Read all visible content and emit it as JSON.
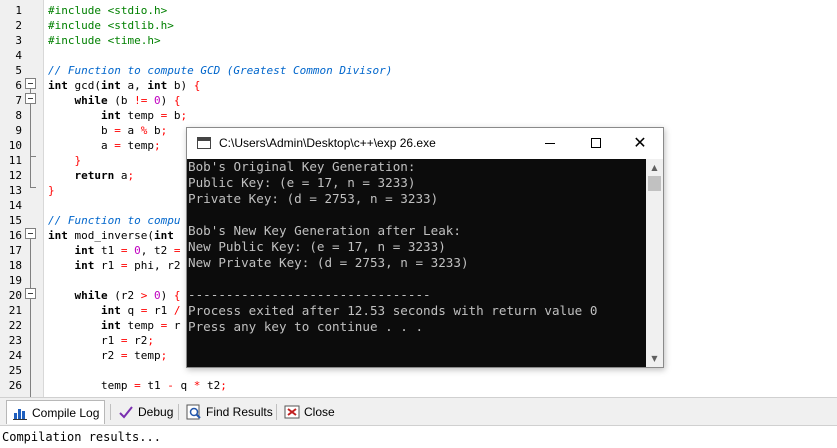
{
  "editor": {
    "lines": [
      {
        "n": "1",
        "tokens": [
          {
            "t": "#include <stdio.h>",
            "c": "tok-pre"
          }
        ]
      },
      {
        "n": "2",
        "tokens": [
          {
            "t": "#include <stdlib.h>",
            "c": "tok-pre"
          }
        ]
      },
      {
        "n": "3",
        "tokens": [
          {
            "t": "#include <time.h>",
            "c": "tok-pre"
          }
        ]
      },
      {
        "n": "4",
        "tokens": []
      },
      {
        "n": "5",
        "tokens": [
          {
            "t": "// Function to compute GCD (Greatest Common Divisor)",
            "c": "tok-cm"
          }
        ]
      },
      {
        "n": "6",
        "tokens": [
          {
            "t": "int",
            "c": "tok-kw"
          },
          {
            "t": " gcd(",
            "c": ""
          },
          {
            "t": "int",
            "c": "tok-kw"
          },
          {
            "t": " a, ",
            "c": ""
          },
          {
            "t": "int",
            "c": "tok-kw"
          },
          {
            "t": " b) ",
            "c": ""
          },
          {
            "t": "{",
            "c": "tok-op"
          }
        ]
      },
      {
        "n": "7",
        "tokens": [
          {
            "t": "    ",
            "c": ""
          },
          {
            "t": "while",
            "c": "tok-kw"
          },
          {
            "t": " (b ",
            "c": ""
          },
          {
            "t": "!=",
            "c": "tok-op"
          },
          {
            "t": " ",
            "c": ""
          },
          {
            "t": "0",
            "c": "tok-num"
          },
          {
            "t": ") ",
            "c": ""
          },
          {
            "t": "{",
            "c": "tok-op"
          }
        ]
      },
      {
        "n": "8",
        "tokens": [
          {
            "t": "        ",
            "c": ""
          },
          {
            "t": "int",
            "c": "tok-kw"
          },
          {
            "t": " temp ",
            "c": ""
          },
          {
            "t": "=",
            "c": "tok-op"
          },
          {
            "t": " b",
            "c": ""
          },
          {
            "t": ";",
            "c": "tok-op"
          }
        ]
      },
      {
        "n": "9",
        "tokens": [
          {
            "t": "        b ",
            "c": ""
          },
          {
            "t": "=",
            "c": "tok-op"
          },
          {
            "t": " a ",
            "c": ""
          },
          {
            "t": "%",
            "c": "tok-op"
          },
          {
            "t": " b",
            "c": ""
          },
          {
            "t": ";",
            "c": "tok-op"
          }
        ]
      },
      {
        "n": "10",
        "tokens": [
          {
            "t": "        a ",
            "c": ""
          },
          {
            "t": "=",
            "c": "tok-op"
          },
          {
            "t": " temp",
            "c": ""
          },
          {
            "t": ";",
            "c": "tok-op"
          }
        ]
      },
      {
        "n": "11",
        "tokens": [
          {
            "t": "    ",
            "c": ""
          },
          {
            "t": "}",
            "c": "tok-op"
          }
        ]
      },
      {
        "n": "12",
        "tokens": [
          {
            "t": "    ",
            "c": ""
          },
          {
            "t": "return",
            "c": "tok-kw"
          },
          {
            "t": " a",
            "c": ""
          },
          {
            "t": ";",
            "c": "tok-op"
          }
        ]
      },
      {
        "n": "13",
        "tokens": [
          {
            "t": "}",
            "c": "tok-op"
          }
        ]
      },
      {
        "n": "14",
        "tokens": []
      },
      {
        "n": "15",
        "tokens": [
          {
            "t": "// Function to compu",
            "c": "tok-cm"
          }
        ]
      },
      {
        "n": "16",
        "tokens": [
          {
            "t": "int",
            "c": "tok-kw"
          },
          {
            "t": " mod_inverse(",
            "c": ""
          },
          {
            "t": "int",
            "c": "tok-kw"
          }
        ]
      },
      {
        "n": "17",
        "tokens": [
          {
            "t": "    ",
            "c": ""
          },
          {
            "t": "int",
            "c": "tok-kw"
          },
          {
            "t": " t1 ",
            "c": ""
          },
          {
            "t": "=",
            "c": "tok-op"
          },
          {
            "t": " ",
            "c": ""
          },
          {
            "t": "0",
            "c": "tok-num"
          },
          {
            "t": ", t2 ",
            "c": ""
          },
          {
            "t": "=",
            "c": "tok-op"
          }
        ]
      },
      {
        "n": "18",
        "tokens": [
          {
            "t": "    ",
            "c": ""
          },
          {
            "t": "int",
            "c": "tok-kw"
          },
          {
            "t": " r1 ",
            "c": ""
          },
          {
            "t": "=",
            "c": "tok-op"
          },
          {
            "t": " phi, r2",
            "c": ""
          }
        ]
      },
      {
        "n": "19",
        "tokens": []
      },
      {
        "n": "20",
        "tokens": [
          {
            "t": "    ",
            "c": ""
          },
          {
            "t": "while",
            "c": "tok-kw"
          },
          {
            "t": " (r2 ",
            "c": ""
          },
          {
            "t": ">",
            "c": "tok-op"
          },
          {
            "t": " ",
            "c": ""
          },
          {
            "t": "0",
            "c": "tok-num"
          },
          {
            "t": ") ",
            "c": ""
          },
          {
            "t": "{",
            "c": "tok-op"
          }
        ]
      },
      {
        "n": "21",
        "tokens": [
          {
            "t": "        ",
            "c": ""
          },
          {
            "t": "int",
            "c": "tok-kw"
          },
          {
            "t": " q ",
            "c": ""
          },
          {
            "t": "=",
            "c": "tok-op"
          },
          {
            "t": " r1 ",
            "c": ""
          },
          {
            "t": "/",
            "c": "tok-op"
          }
        ]
      },
      {
        "n": "22",
        "tokens": [
          {
            "t": "        ",
            "c": ""
          },
          {
            "t": "int",
            "c": "tok-kw"
          },
          {
            "t": " temp ",
            "c": ""
          },
          {
            "t": "=",
            "c": "tok-op"
          },
          {
            "t": " r",
            "c": ""
          }
        ]
      },
      {
        "n": "23",
        "tokens": [
          {
            "t": "        r1 ",
            "c": ""
          },
          {
            "t": "=",
            "c": "tok-op"
          },
          {
            "t": " r2",
            "c": ""
          },
          {
            "t": ";",
            "c": "tok-op"
          }
        ]
      },
      {
        "n": "24",
        "tokens": [
          {
            "t": "        r2 ",
            "c": ""
          },
          {
            "t": "=",
            "c": "tok-op"
          },
          {
            "t": " temp",
            "c": ""
          },
          {
            "t": ";",
            "c": "tok-op"
          }
        ]
      },
      {
        "n": "25",
        "tokens": []
      },
      {
        "n": "26",
        "tokens": [
          {
            "t": "        temp ",
            "c": ""
          },
          {
            "t": "=",
            "c": "tok-op"
          },
          {
            "t": " t1 ",
            "c": ""
          },
          {
            "t": "-",
            "c": "tok-op"
          },
          {
            "t": " q ",
            "c": ""
          },
          {
            "t": "*",
            "c": "tok-op"
          },
          {
            "t": " t2",
            "c": ""
          },
          {
            "t": ";",
            "c": "tok-op"
          }
        ]
      }
    ]
  },
  "console": {
    "title": "C:\\Users\\Admin\\Desktop\\c++\\exp 26.exe",
    "icon": "console-app-icon",
    "controls": {
      "minimize": "minimize-icon",
      "maximize": "maximize-icon",
      "close": "close-icon"
    },
    "lines": [
      "Bob's Original Key Generation:",
      "Public Key: (e = 17, n = 3233)",
      "Private Key: (d = 2753, n = 3233)",
      "",
      "Bob's New Key Generation after Leak:",
      "New Public Key: (e = 17, n = 3233)",
      "New Private Key: (d = 2753, n = 3233)",
      "",
      "--------------------------------",
      "Process exited after 12.53 seconds with return value 0",
      "Press any key to continue . . ."
    ]
  },
  "bottom_tabs": [
    {
      "label": "Compile Log",
      "icon": "compile-log-icon",
      "active": true
    },
    {
      "label": "Debug",
      "icon": "debug-check-icon",
      "active": false
    },
    {
      "label": "Find Results",
      "icon": "find-results-icon",
      "active": false
    },
    {
      "label": "Close",
      "icon": "close-panel-icon",
      "active": false
    }
  ],
  "status": {
    "text": "Compilation results..."
  },
  "colors": {
    "console_bg": "#0c0c0c",
    "console_fg": "#c0c0c0",
    "preprocessor": "#008000",
    "comment": "#0066cc",
    "number": "#c000c0",
    "operator": "#ff0000"
  }
}
